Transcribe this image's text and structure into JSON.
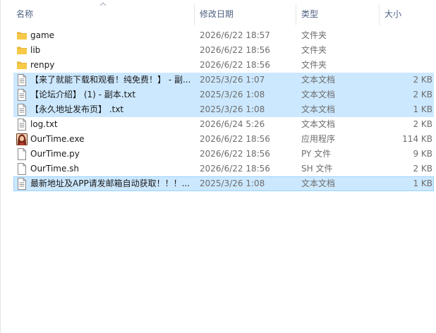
{
  "columns": {
    "name": "名称",
    "date": "修改日期",
    "type": "类型",
    "size": "大小"
  },
  "files": [
    {
      "name": "game",
      "date": "2026/6/22 18:57",
      "type": "文件夹",
      "size": "",
      "icon": "folder-icon",
      "selected": false
    },
    {
      "name": "lib",
      "date": "2026/6/22 18:56",
      "type": "文件夹",
      "size": "",
      "icon": "folder-icon",
      "selected": false
    },
    {
      "name": "renpy",
      "date": "2026/6/22 18:56",
      "type": "文件夹",
      "size": "",
      "icon": "folder-icon",
      "selected": false
    },
    {
      "name": "【来了就能下载和观看！纯免费！】 - 副...",
      "date": "2025/3/26 1:07",
      "type": "文本文档",
      "size": "2 KB",
      "icon": "text-file-icon",
      "selected": true
    },
    {
      "name": "【论坛介绍】 (1) - 副本.txt",
      "date": "2025/3/26 1:08",
      "type": "文本文档",
      "size": "2 KB",
      "icon": "text-file-icon",
      "selected": true
    },
    {
      "name": "【永久地址发布页】 .txt",
      "date": "2025/3/26 1:08",
      "type": "文本文档",
      "size": "1 KB",
      "icon": "text-file-icon",
      "selected": true
    },
    {
      "name": "log.txt",
      "date": "2026/6/24 5:26",
      "type": "文本文档",
      "size": "2 KB",
      "icon": "text-file-icon",
      "selected": false
    },
    {
      "name": "OurTime.exe",
      "date": "2026/6/22 18:56",
      "type": "应用程序",
      "size": "114 KB",
      "icon": "app-icon",
      "selected": false
    },
    {
      "name": "OurTime.py",
      "date": "2026/6/22 18:56",
      "type": "PY 文件",
      "size": "9 KB",
      "icon": "blank-file-icon",
      "selected": false
    },
    {
      "name": "OurTime.sh",
      "date": "2026/6/22 18:56",
      "type": "SH 文件",
      "size": "2 KB",
      "icon": "blank-file-icon",
      "selected": false
    },
    {
      "name": "最新地址及APP请发邮箱自动获取！！！...",
      "date": "2025/3/26 1:08",
      "type": "文本文档",
      "size": "1 KB",
      "icon": "text-file-icon",
      "selected": true,
      "focused": true
    }
  ],
  "colors": {
    "selection": "#cce8ff",
    "focus_border": "#99d1ff",
    "header_text": "#4d6082",
    "folder": "#f7c948"
  }
}
